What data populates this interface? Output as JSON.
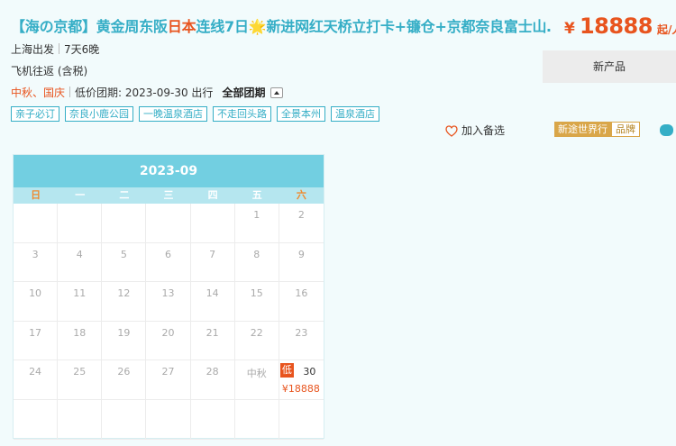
{
  "product": {
    "title_pre": "【海の京都】黄金周东阪",
    "title_red": "日本",
    "title_post": "连线7日🌟新进网红天桥立打卡+镰仓+京都奈良富士山",
    "title_ellipsis": "…",
    "price_currency": "¥",
    "price": "18888",
    "price_suffix": "起/人",
    "price_chevron": ">",
    "departure": "上海出发",
    "duration": "7天6晚",
    "transport": "飞机往返 (含税)",
    "festivals": "中秋、国庆",
    "low_price_group": "低价团期: 2023-09-30 出行",
    "all_groups": "全部团期",
    "new_product": "新产品",
    "wishlist": "加入备选",
    "brand_name": "新途世界行",
    "brand_tag": "品牌"
  },
  "tags": [
    "亲子必订",
    "奈良小鹿公园",
    "一晚温泉酒店",
    "不走回头路",
    "全景本州",
    "温泉酒店"
  ],
  "calendar": {
    "month": "2023-09",
    "weekdays": [
      "日",
      "一",
      "二",
      "三",
      "四",
      "五",
      "六"
    ],
    "cells": [
      {
        "d": ""
      },
      {
        "d": ""
      },
      {
        "d": ""
      },
      {
        "d": ""
      },
      {
        "d": ""
      },
      {
        "d": "1"
      },
      {
        "d": "2"
      },
      {
        "d": "3"
      },
      {
        "d": "4"
      },
      {
        "d": "5"
      },
      {
        "d": "6"
      },
      {
        "d": "7"
      },
      {
        "d": "8"
      },
      {
        "d": "9"
      },
      {
        "d": "10"
      },
      {
        "d": "11"
      },
      {
        "d": "12"
      },
      {
        "d": "13"
      },
      {
        "d": "14"
      },
      {
        "d": "15"
      },
      {
        "d": "16"
      },
      {
        "d": "17"
      },
      {
        "d": "18"
      },
      {
        "d": "19"
      },
      {
        "d": "20"
      },
      {
        "d": "21"
      },
      {
        "d": "22"
      },
      {
        "d": "23"
      },
      {
        "d": "24"
      },
      {
        "d": "25"
      },
      {
        "d": "26"
      },
      {
        "d": "27"
      },
      {
        "d": "28"
      },
      {
        "d": "中秋"
      },
      {
        "d": "30",
        "badge": "低",
        "price": "¥18888"
      },
      {
        "d": ""
      },
      {
        "d": ""
      },
      {
        "d": ""
      },
      {
        "d": ""
      },
      {
        "d": ""
      },
      {
        "d": ""
      },
      {
        "d": ""
      }
    ]
  },
  "colors": {
    "accent": "#35aec6",
    "price": "#e8541e",
    "calendar_header": "#72cfe1",
    "brand": "#d9a649"
  }
}
